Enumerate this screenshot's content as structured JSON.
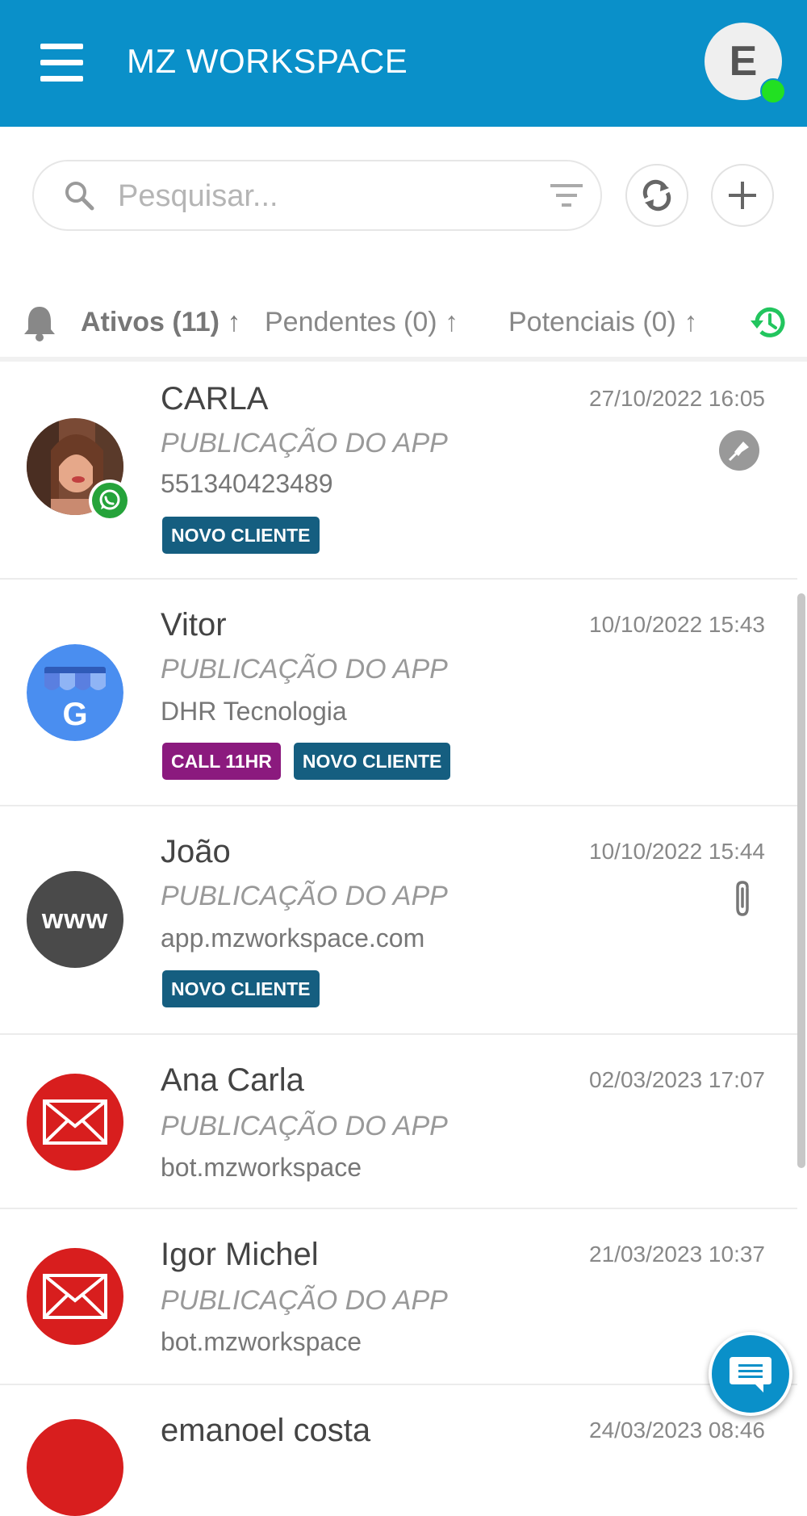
{
  "header": {
    "title": "MZ WORKSPACE",
    "avatar_letter": "E"
  },
  "search": {
    "placeholder": "Pesquisar..."
  },
  "tabs": [
    {
      "label": "Ativos (11) ↑",
      "active": true
    },
    {
      "label": "Pendentes (0) ↑",
      "active": false
    },
    {
      "label": "Potenciais (0) ↑",
      "active": false
    }
  ],
  "conversations": [
    {
      "name": "CARLA",
      "subtitle": "PUBLICAÇÃO DO APP",
      "detail": "551340423489",
      "date": "27/10/2022 16:05",
      "avatar": "photo-with-whatsapp-badge",
      "indicator": "pin-icon",
      "tags": [
        {
          "label": "NOVO CLIENTE",
          "color": "#155e80"
        }
      ]
    },
    {
      "name": "Vitor",
      "subtitle": "PUBLICAÇÃO DO APP",
      "detail": "DHR Tecnologia",
      "date": "10/10/2022 15:43",
      "avatar": "google-business-icon",
      "tags": [
        {
          "label": "CALL 11HR",
          "color": "#8b1a7e"
        },
        {
          "label": "NOVO CLIENTE",
          "color": "#155e80"
        }
      ]
    },
    {
      "name": "João",
      "subtitle": "PUBLICAÇÃO DO APP",
      "detail": "app.mzworkspace.com",
      "date": "10/10/2022 15:44",
      "avatar": "www-icon",
      "avatar_text": "www",
      "indicator": "attachment-icon",
      "tags": [
        {
          "label": "NOVO CLIENTE",
          "color": "#155e80"
        }
      ]
    },
    {
      "name": "Ana Carla",
      "subtitle": "PUBLICAÇÃO DO APP",
      "detail": "bot.mzworkspace",
      "date": "02/03/2023 17:07",
      "avatar": "email-icon",
      "tags": []
    },
    {
      "name": "Igor Michel",
      "subtitle": "PUBLICAÇÃO DO APP",
      "detail": "bot.mzworkspace",
      "date": "21/03/2023 10:37",
      "avatar": "email-icon",
      "tags": []
    },
    {
      "name": "emanoel costa",
      "date": "24/03/2023 08:46",
      "avatar": "email-icon",
      "tags": []
    }
  ],
  "colors": {
    "header": "#0a90c9",
    "tab_underline": "#10a5c0",
    "history_icon": "#22c55e",
    "email_avatar": "#d81e1e",
    "whatsapp": "#25a33a"
  }
}
